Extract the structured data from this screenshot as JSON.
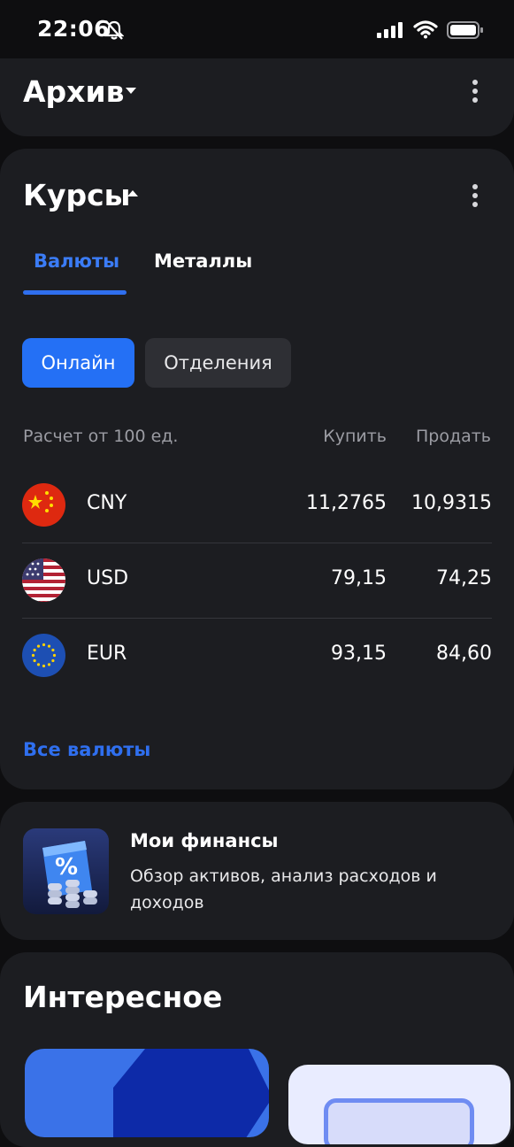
{
  "status_bar": {
    "time": "22:06",
    "icons": [
      "bell-slash-icon",
      "signal-icon",
      "wifi-icon",
      "battery-icon"
    ]
  },
  "archive": {
    "title": "Архив"
  },
  "rates": {
    "title": "Курсы",
    "tabs": [
      {
        "label": "Валюты",
        "active": true
      },
      {
        "label": "Металлы",
        "active": false
      }
    ],
    "filters": [
      {
        "label": "Онлайн",
        "active": true
      },
      {
        "label": "Отделения",
        "active": false
      }
    ],
    "table": {
      "header_calc": "Расчет от 100 ед.",
      "header_buy": "Купить",
      "header_sell": "Продать",
      "rows": [
        {
          "code": "CNY",
          "buy": "11,2765",
          "sell": "10,9315",
          "flag": "china-flag-icon"
        },
        {
          "code": "USD",
          "buy": "79,15",
          "sell": "74,25",
          "flag": "usa-flag-icon"
        },
        {
          "code": "EUR",
          "buy": "93,15",
          "sell": "84,60",
          "flag": "eu-flag-icon"
        }
      ]
    },
    "all_link": "Все валюты"
  },
  "finance": {
    "title": "Мои финансы",
    "description": "Обзор активов, анализ расходов и доходов",
    "icon": "percent-coins-icon"
  },
  "interest": {
    "title": "Интересное"
  },
  "colors": {
    "background": "#0e0e10",
    "card": "#1c1d21",
    "accent": "#2470f5",
    "link": "#2f6fef",
    "muted_text": "#9b9ca3"
  }
}
